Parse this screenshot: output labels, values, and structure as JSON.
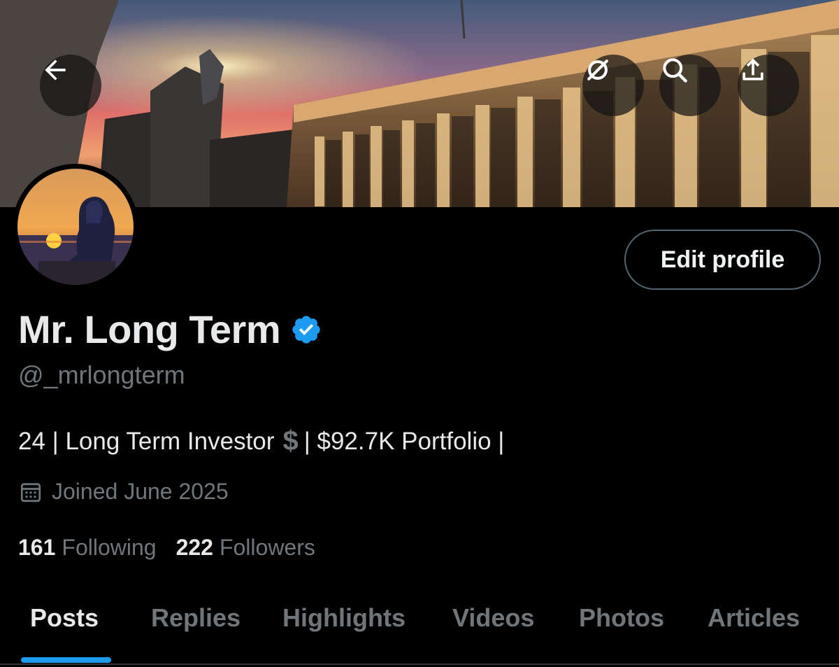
{
  "header": {
    "back_icon": "arrow-left-icon",
    "grok_icon": "grok-icon",
    "search_icon": "search-icon",
    "share_icon": "share-icon"
  },
  "profile": {
    "edit_label": "Edit profile",
    "display_name": "Mr. Long Term",
    "verified": true,
    "handle": "@_mrlongterm",
    "bio_part1": "24 | Long Term Investor",
    "bio_part2": "| $92.7K Portfolio |",
    "joined": "Joined June 2025",
    "following_count": "161",
    "following_label": "Following",
    "followers_count": "222",
    "followers_label": "Followers"
  },
  "tabs": [
    {
      "label": "Posts",
      "active": true
    },
    {
      "label": "Replies",
      "active": false
    },
    {
      "label": "Highlights",
      "active": false
    },
    {
      "label": "Videos",
      "active": false
    },
    {
      "label": "Photos",
      "active": false
    },
    {
      "label": "Articles",
      "active": false
    }
  ],
  "colors": {
    "accent": "#1d9bf0",
    "verified": "#1d9bf0",
    "muted": "#71767b",
    "text": "#e7e9ea",
    "background": "#000000"
  }
}
